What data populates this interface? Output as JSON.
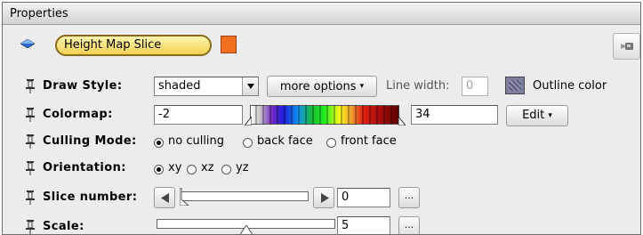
{
  "window": {
    "title": "Properties"
  },
  "header": {
    "module_name": "Height Map Slice",
    "module_color": "#f07020"
  },
  "draw_style": {
    "label": "Draw Style:",
    "selected": "shaded",
    "more_options_label": "more options",
    "line_width_label": "Line width:",
    "line_width_value": "0",
    "outline_color_label": "Outline color"
  },
  "colormap": {
    "label": "Colormap:",
    "min_value": "-2",
    "max_value": "34",
    "edit_label": "Edit"
  },
  "culling": {
    "label": "Culling Mode:",
    "options": [
      "no culling",
      "back face",
      "front face"
    ],
    "selected": "no culling"
  },
  "orientation": {
    "label": "Orientation:",
    "options": [
      "xy",
      "xz",
      "yz"
    ],
    "selected": "xy"
  },
  "slice_number": {
    "label": "Slice number:",
    "value": "0",
    "more_label": "...",
    "level": 0
  },
  "scale": {
    "label": "Scale:",
    "value": "5",
    "more_label": "...",
    "level": 0.5
  }
}
